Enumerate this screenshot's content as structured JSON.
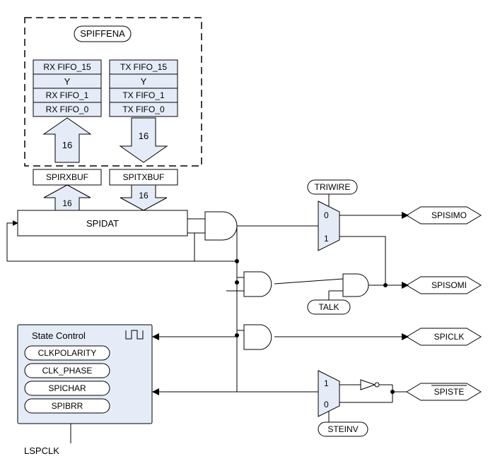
{
  "title_pill": "SPIFFENA",
  "rx_fifo": {
    "top": "RX FIFO_15",
    "mid": "Y",
    "a": "RX FIFO_1",
    "b": "RX FIFO_0"
  },
  "tx_fifo": {
    "top": "TX FIFO_15",
    "mid": "Y",
    "a": "TX FIFO_1",
    "b": "TX FIFO_0"
  },
  "bufs": {
    "rx": "SPIRXBUF",
    "tx": "SPITXBUF"
  },
  "bus_widths": {
    "rx_top": "16",
    "tx_top": "16",
    "rx_bot": "16",
    "tx_bot": "16"
  },
  "spidat": "SPIDAT",
  "state": {
    "title": "State Control",
    "p1": "CLKPOLARITY",
    "p2": "CLK_PHASE",
    "p3": "SPICHAR",
    "p4": "SPIBRR"
  },
  "lspclk": "LSPCLK",
  "signals": {
    "triwire": "TRIWIRE",
    "talk": "TALK",
    "steinv": "STEINV",
    "spisimo": "SPISIMO",
    "spisomi": "SPISOMI",
    "spiclk": "SPICLK",
    "spiste": "SPISTE"
  },
  "mux": {
    "zero": "0",
    "one": "1"
  }
}
